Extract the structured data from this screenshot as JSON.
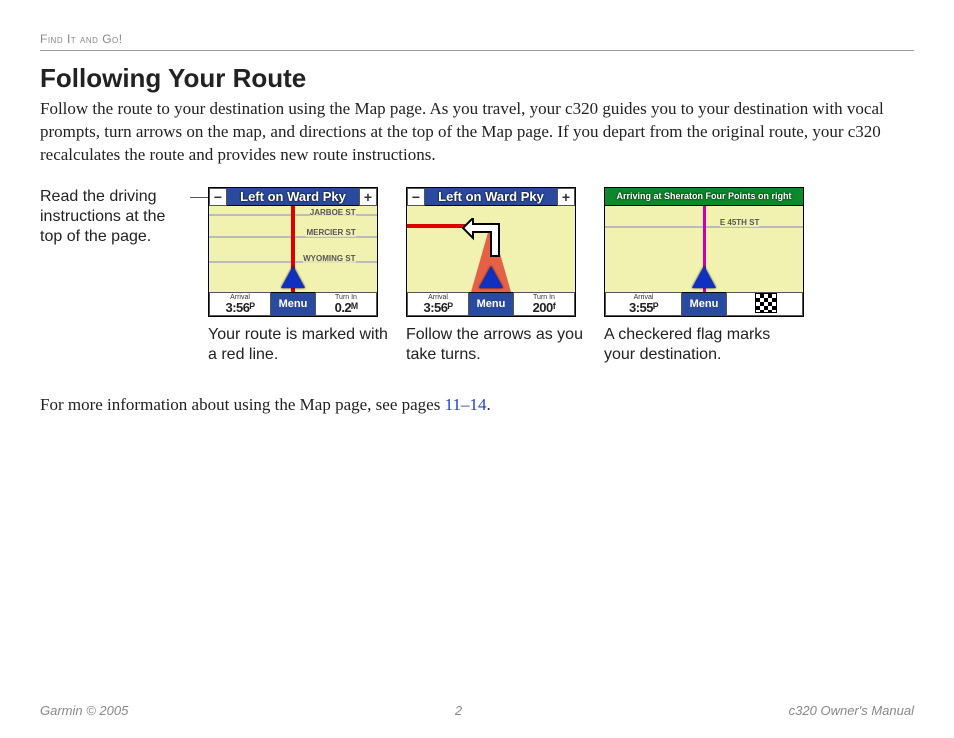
{
  "breadcrumb": "Find It and Go!",
  "title": "Following Your Route",
  "intro": "Follow the route to your destination using the Map page. As you travel, your c320 guides you to your destination with vocal prompts, turn arrows on the map, and directions at the top of the Map page. If you depart from the original route, your c320 recalculates the route and provides new route instructions.",
  "side_note": "Read the driving instructions at the top of the page.",
  "screens": [
    {
      "direction": "Left on Ward Pky",
      "roads": [
        "JARBOE ST",
        "MERCIER ST",
        "WYOMING ST"
      ],
      "arrival_label": "Arrival",
      "arrival": "3:56ᴾ",
      "menu": "Menu",
      "turnin_label": "Turn In",
      "turnin": "0.2ᴹ",
      "caption": "Your route is marked with a red line."
    },
    {
      "direction": "Left on Ward Pky",
      "arrival_label": "Arrival",
      "arrival": "3:56ᴾ",
      "menu": "Menu",
      "turnin_label": "Turn In",
      "turnin": "200ᶠ",
      "caption": "Follow the arrows as you take turns."
    },
    {
      "direction": "Arriving at Sheraton Four Points on right",
      "road": "E 45TH ST",
      "arrival_label": "Arrival",
      "arrival": "3:55ᴾ",
      "menu": "Menu",
      "caption": "A checkered flag marks your destination."
    }
  ],
  "more_info_pre": "For more information about using the Map page, see pages ",
  "more_info_link": "11–14",
  "more_info_post": ".",
  "footer": {
    "left": "Garmin © 2005",
    "center": "2",
    "right": "c320 Owner's Manual"
  }
}
